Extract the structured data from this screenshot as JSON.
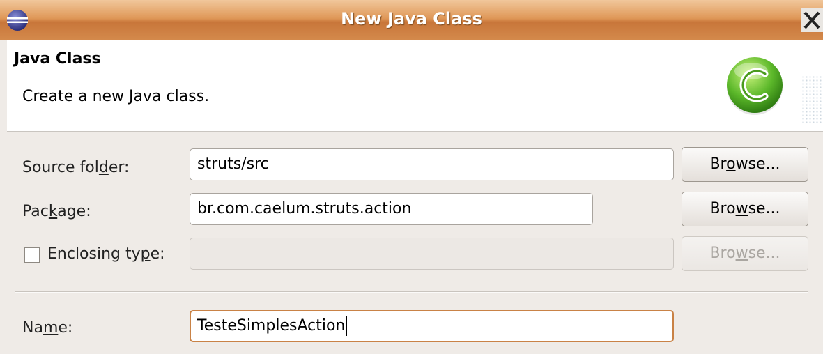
{
  "window": {
    "title": "New Java Class",
    "icon": "eclipse-icon",
    "close_icon": "close-icon"
  },
  "banner": {
    "title": "Java Class",
    "description": "Create a new Java class.",
    "icon": "java-class-icon"
  },
  "form": {
    "source_folder": {
      "label_pre": "Source fol",
      "label_mnemonic": "d",
      "label_post": "er:",
      "value": "struts/src",
      "browse_pre": "Br",
      "browse_mnemonic": "o",
      "browse_post": "wse..."
    },
    "package": {
      "label_pre": "Pac",
      "label_mnemonic": "k",
      "label_post": "age:",
      "value": "br.com.caelum.struts.action",
      "browse_pre": "Bro",
      "browse_mnemonic": "w",
      "browse_post": "se..."
    },
    "enclosing_type": {
      "checked": false,
      "label_pre": "Enclosing ty",
      "label_mnemonic": "p",
      "label_post": "e:",
      "value": "",
      "browse_pre": "Bro",
      "browse_mnemonic": "w",
      "browse_post": "se..."
    },
    "name": {
      "label_pre": "Na",
      "label_mnemonic": "m",
      "label_post": "e:",
      "value": "TesteSimplesAction"
    }
  },
  "colors": {
    "titlebar": "#df9858",
    "focus_border": "#c98246",
    "dialog_bg": "#efebe7"
  }
}
